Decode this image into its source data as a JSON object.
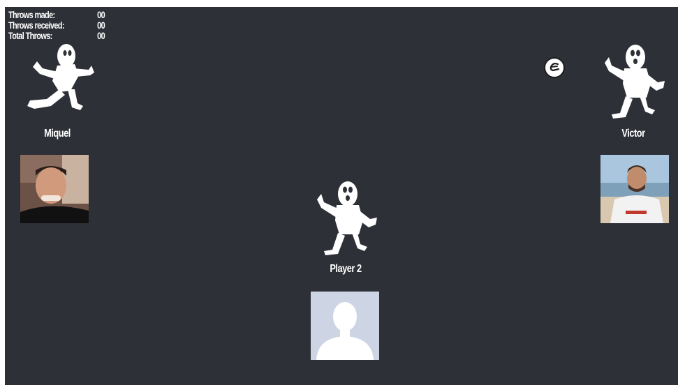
{
  "stats": {
    "throws_made_label": "Throws made:",
    "throws_made_value": "00",
    "throws_received_label": "Throws received:",
    "throws_received_value": "00",
    "total_throws_label": "Total Throws:",
    "total_throws_value": "00"
  },
  "players": {
    "left": {
      "name": "Miquel",
      "figure_icon": "running-person-icon",
      "avatar": "photo"
    },
    "right": {
      "name": "Victor",
      "figure_icon": "waving-person-icon",
      "avatar": "photo"
    },
    "bottom": {
      "name": "Player 2",
      "figure_icon": "waving-person-icon",
      "avatar": "default-silhouette"
    }
  },
  "ball": {
    "icon": "ball-icon"
  },
  "colors": {
    "background": "#2e3037",
    "text": "#ffffff",
    "figure": "#ffffff",
    "default_avatar_bg": "#cdd5e4"
  }
}
